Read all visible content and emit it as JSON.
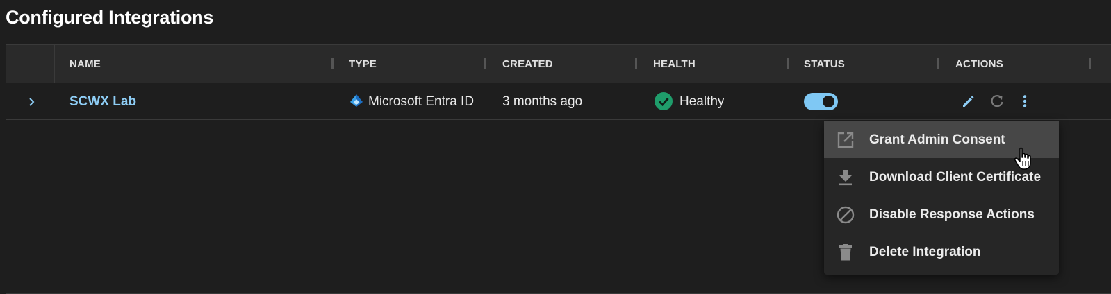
{
  "page": {
    "title": "Configured Integrations"
  },
  "table": {
    "columns": [
      "NAME",
      "TYPE",
      "CREATED",
      "HEALTH",
      "STATUS",
      "ACTIONS"
    ],
    "rows": [
      {
        "name": "SCWX Lab",
        "type": "Microsoft Entra ID",
        "created": "3 months ago",
        "health": "Healthy",
        "status_enabled": true
      }
    ]
  },
  "icons": {
    "expand": "chevron-right-icon",
    "type": "microsoft-entra-icon",
    "health": "check-circle-icon",
    "edit": "pencil-icon",
    "refresh": "refresh-icon",
    "more": "more-vertical-icon"
  },
  "actions_menu": {
    "items": [
      {
        "label": "Grant Admin Consent",
        "icon": "open-external-icon",
        "hovered": true
      },
      {
        "label": "Download Client Certificate",
        "icon": "download-icon"
      },
      {
        "label": "Disable Response Actions",
        "icon": "block-icon"
      },
      {
        "label": "Delete Integration",
        "icon": "trash-icon"
      }
    ]
  },
  "colors": {
    "background": "#1e1e1e",
    "header": "#2a2a2a",
    "link": "#8ecdf5",
    "toggle_on": "#7fc8f4",
    "healthy": "#1f9d6b",
    "menu_bg": "#262626",
    "menu_hover": "#474747"
  }
}
